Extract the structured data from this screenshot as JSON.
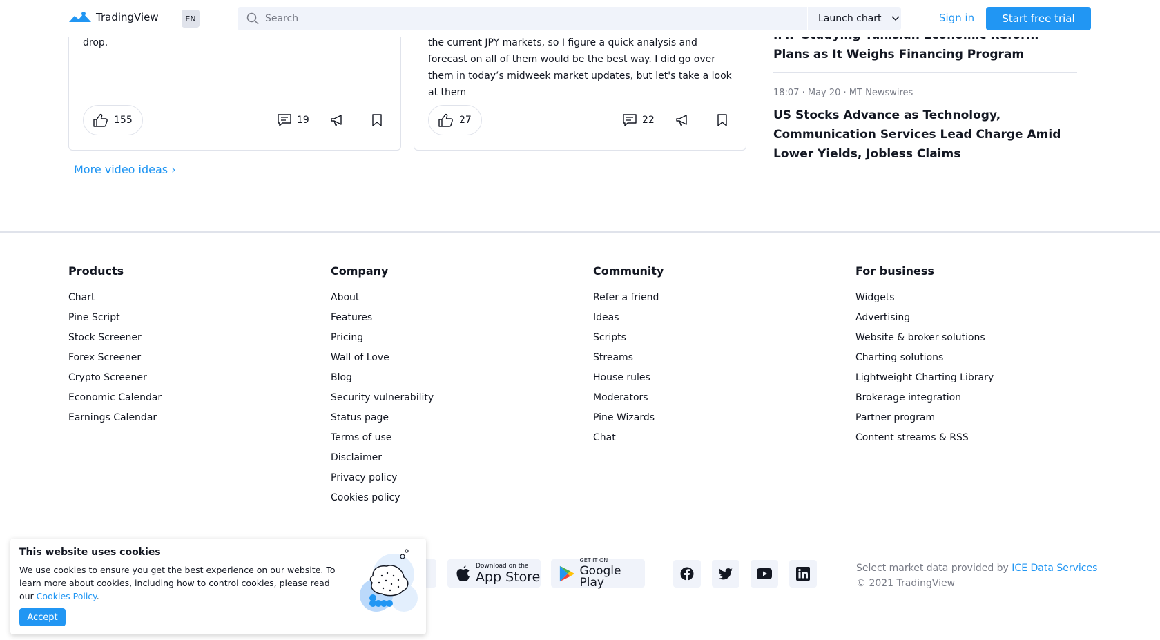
{
  "header": {
    "brand": "TradingView",
    "language": "EN",
    "search_placeholder": "Search",
    "launch_chart": "Launch chart",
    "sign_in": "Sign in",
    "start_trial": "Start free trial"
  },
  "ideas": [
    {
      "text": "drop.",
      "likes": "155",
      "comments": "19"
    },
    {
      "text": "the current JPY markets, so I figure a quick analysis and forecast on all of them would be the best way. I did go over them in today’s midweek market updates, but let's take a look at them",
      "likes": "27",
      "comments": "22"
    }
  ],
  "more_ideas": "More video ideas ›",
  "news": [
    {
      "headline": "IMF Studying Tunisian Economic Reform Plans as It Weighs Financing Program"
    },
    {
      "meta": "18:07 · May 20 · MT Newswires",
      "headline": "US Stocks Advance as Technology, Communication Services Lead Charge Amid Lower Yields, Jobless Claims"
    }
  ],
  "footer": {
    "columns": [
      {
        "title": "Products",
        "links": [
          "Chart",
          "Pine Script",
          "Stock Screener",
          "Forex Screener",
          "Crypto Screener",
          "Economic Calendar",
          "Earnings Calendar"
        ]
      },
      {
        "title": "Company",
        "links": [
          "About",
          "Features",
          "Pricing",
          "Wall of Love",
          "Blog",
          "Security vulnerability",
          "Status page",
          "Terms of use",
          "Disclaimer",
          "Privacy policy",
          "Cookies policy"
        ]
      },
      {
        "title": "Community",
        "links": [
          "Refer a friend",
          "Ideas",
          "Scripts",
          "Streams",
          "House rules",
          "Moderators",
          "Pine Wizards",
          "Chat"
        ]
      },
      {
        "title": "For business",
        "links": [
          "Widgets",
          "Advertising",
          "Website & broker solutions",
          "Charting solutions",
          "Lightweight Charting Library",
          "Brokerage integration",
          "Partner program",
          "Content streams & RSS"
        ]
      }
    ],
    "app_store": {
      "small": "Download on the",
      "big": "App Store"
    },
    "google_play": {
      "small": "GET IT ON",
      "big": "Google Play"
    },
    "market_data_text": "Select market data provided by",
    "market_data_link": "ICE Data Services",
    "copyright": "© 2021 TradingView",
    "social_icons": [
      "facebook-icon",
      "twitter-icon",
      "youtube-icon",
      "linkedin-icon"
    ]
  },
  "cookie": {
    "title": "This website uses cookies",
    "body": "We use cookies to ensure you get the best experience on our website. To learn more about cookies, including how to control cookies, please read our",
    "link": "Cookies Policy",
    "accept": "Accept"
  },
  "colors": {
    "accent": "#2196f3",
    "text": "#131722",
    "muted": "#787b86",
    "border": "#e0e3eb",
    "surface": "#f0f3fa"
  }
}
